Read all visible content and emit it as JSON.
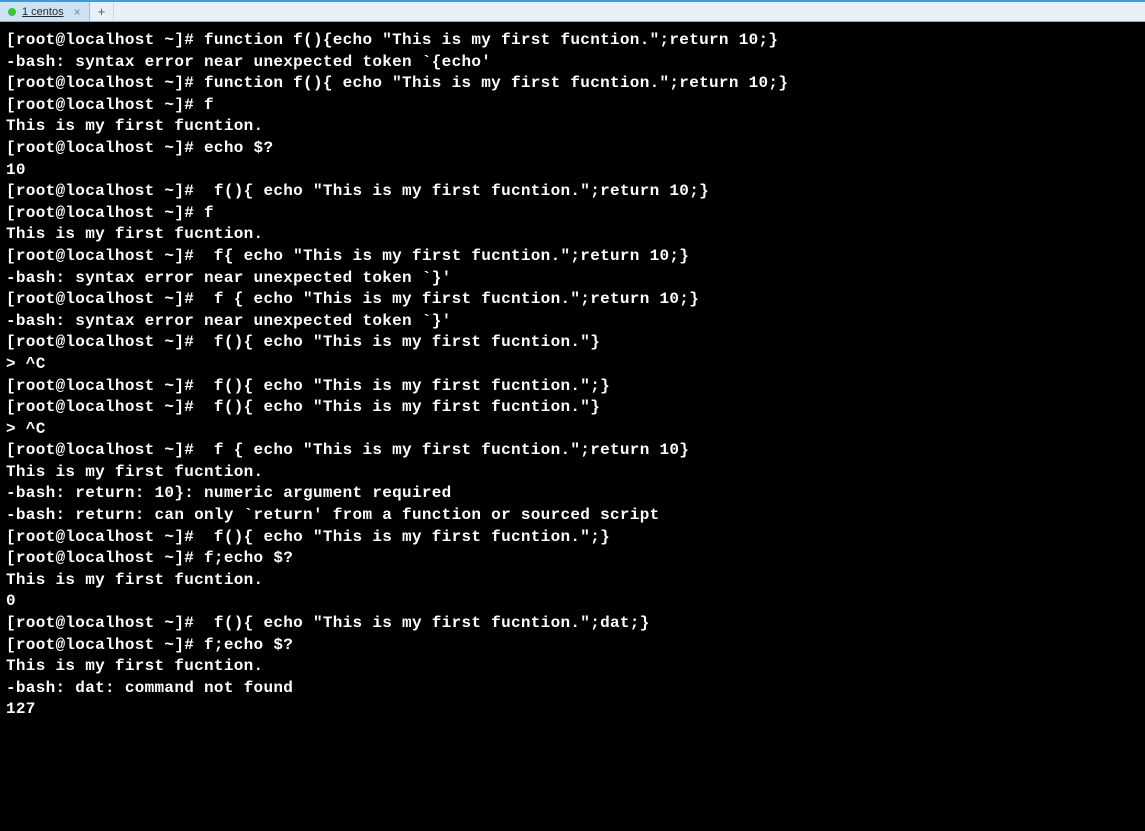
{
  "tabs": {
    "items": [
      {
        "label": "1 centos"
      }
    ],
    "add_label": "+"
  },
  "terminal": {
    "prompt": "[root@localhost ~]# ",
    "continuation": "> ",
    "lines": [
      {
        "type": "cmd",
        "text": "function f(){echo \"This is my first fucntion.\";return 10;}"
      },
      {
        "type": "out",
        "text": "-bash: syntax error near unexpected token `{echo'"
      },
      {
        "type": "cmd",
        "text": "function f(){ echo \"This is my first fucntion.\";return 10;}"
      },
      {
        "type": "cmd",
        "text": "f"
      },
      {
        "type": "out",
        "text": "This is my first fucntion."
      },
      {
        "type": "cmd",
        "text": "echo $?"
      },
      {
        "type": "out",
        "text": "10"
      },
      {
        "type": "cmd",
        "text": " f(){ echo \"This is my first fucntion.\";return 10;}"
      },
      {
        "type": "cmd",
        "text": "f"
      },
      {
        "type": "out",
        "text": "This is my first fucntion."
      },
      {
        "type": "cmd",
        "text": " f{ echo \"This is my first fucntion.\";return 10;}"
      },
      {
        "type": "out",
        "text": "-bash: syntax error near unexpected token `}'"
      },
      {
        "type": "cmd",
        "text": " f { echo \"This is my first fucntion.\";return 10;}"
      },
      {
        "type": "out",
        "text": "-bash: syntax error near unexpected token `}'"
      },
      {
        "type": "cmd",
        "text": " f(){ echo \"This is my first fucntion.\"}"
      },
      {
        "type": "cont",
        "text": "^C"
      },
      {
        "type": "cmd",
        "text": " f(){ echo \"This is my first fucntion.\";}"
      },
      {
        "type": "cmd",
        "text": " f(){ echo \"This is my first fucntion.\"}"
      },
      {
        "type": "cont",
        "text": "^C"
      },
      {
        "type": "cmd",
        "text": " f { echo \"This is my first fucntion.\";return 10}"
      },
      {
        "type": "out",
        "text": "This is my first fucntion."
      },
      {
        "type": "out",
        "text": "-bash: return: 10}: numeric argument required"
      },
      {
        "type": "out",
        "text": "-bash: return: can only `return' from a function or sourced script"
      },
      {
        "type": "cmd",
        "text": " f(){ echo \"This is my first fucntion.\";}"
      },
      {
        "type": "cmd",
        "text": "f;echo $?"
      },
      {
        "type": "out",
        "text": "This is my first fucntion."
      },
      {
        "type": "out",
        "text": "0"
      },
      {
        "type": "cmd",
        "text": " f(){ echo \"This is my first fucntion.\";dat;}"
      },
      {
        "type": "cmd",
        "text": "f;echo $?"
      },
      {
        "type": "out",
        "text": "This is my first fucntion."
      },
      {
        "type": "out",
        "text": "-bash: dat: command not found"
      },
      {
        "type": "out",
        "text": "127"
      }
    ]
  }
}
